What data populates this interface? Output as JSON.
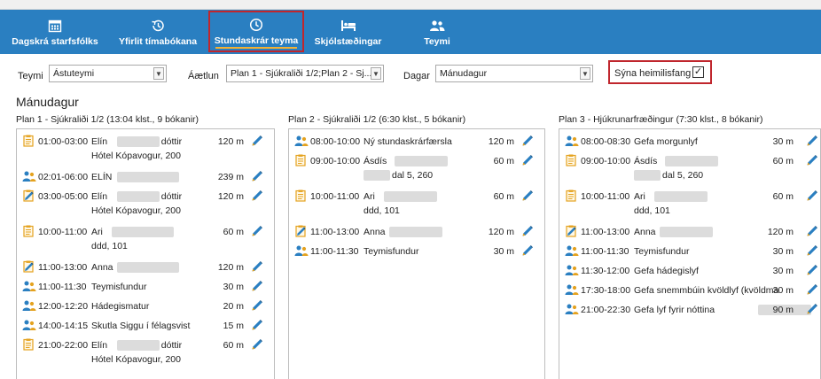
{
  "nav": {
    "items": [
      {
        "label": "Dagskrá starfsfólks",
        "icon": "calendar-icon"
      },
      {
        "label": "Yfirlit tímabókana",
        "icon": "history-icon"
      },
      {
        "label": "Stundaskrár teyma",
        "icon": "clock-icon"
      },
      {
        "label": "Skjólstæðingar",
        "icon": "bed-icon"
      },
      {
        "label": "Teymi",
        "icon": "team-icon"
      }
    ],
    "active_index": 2,
    "colors": {
      "bar": "#2a7fc1",
      "active_border": "#c0262d",
      "active_underline": "#f2b134"
    }
  },
  "filters": {
    "team_label": "Teymi",
    "team_value": "Ástuteymi",
    "plan_label": "Áætlun",
    "plan_value": "Plan 1 - Sjúkraliði 1/2;Plan 2 - Sj...",
    "day_label": "Dagar",
    "day_value": "Mánudagur",
    "show_address_label": "Sýna heimilisfang",
    "show_address_checked": "✓"
  },
  "day_title": "Mánudagur",
  "plans": [
    {
      "title": "Plan 1 - Sjúkraliði 1/2 (13:04 klst., 9 bókanir)",
      "entries": [
        {
          "time": "01:00-03:00",
          "name": "Elín",
          "suffix": "dóttir",
          "minutes": "120 m",
          "icon": "booking-icon",
          "address": "Hótel Kópavogur, 200"
        },
        {
          "time": "02:01-06:00",
          "name": "ELÍN",
          "suffix": "",
          "minutes": "239 m",
          "icon": "group-icon",
          "address": ""
        },
        {
          "time": "03:00-05:00",
          "name": "Elín",
          "suffix": "dóttir",
          "minutes": "120 m",
          "icon": "edited-booking-icon",
          "address": "Hótel Kópavogur, 200"
        },
        {
          "time": "10:00-11:00",
          "name": "Ari",
          "suffix": "",
          "minutes": "60 m",
          "icon": "booking-icon",
          "address": "ddd, 101"
        },
        {
          "time": "11:00-13:00",
          "name": "Anna",
          "suffix": "",
          "minutes": "120 m",
          "icon": "edited-booking-icon",
          "address": ""
        },
        {
          "time": "11:00-11:30",
          "name": "Teymisfundur",
          "suffix": "",
          "minutes": "30 m",
          "icon": "group-icon",
          "address": ""
        },
        {
          "time": "12:00-12:20",
          "name": "Hádegismatur",
          "suffix": "",
          "minutes": "20 m",
          "icon": "group-icon",
          "address": ""
        },
        {
          "time": "14:00-14:15",
          "name": "Skutla Siggu í félagsvist",
          "suffix": "",
          "minutes": "15 m",
          "icon": "group-icon",
          "address": ""
        },
        {
          "time": "21:00-22:00",
          "name": "Elín",
          "suffix": "dóttir",
          "minutes": "60 m",
          "icon": "booking-icon",
          "address": "Hótel Kópavogur, 200"
        }
      ]
    },
    {
      "title": "Plan 2 - Sjúkraliði 1/2 (6:30 klst., 5 bókanir)",
      "entries": [
        {
          "time": "08:00-10:00",
          "name": "Ný stundaskrárfærsla",
          "suffix": "",
          "minutes": "120 m",
          "icon": "group-icon",
          "address": ""
        },
        {
          "time": "09:00-10:00",
          "name": "Ásdís",
          "suffix": "",
          "minutes": "60 m",
          "icon": "booking-icon",
          "address": "dal 5, 260"
        },
        {
          "time": "10:00-11:00",
          "name": "Ari",
          "suffix": "",
          "minutes": "60 m",
          "icon": "booking-icon",
          "address": "ddd, 101"
        },
        {
          "time": "11:00-13:00",
          "name": "Anna",
          "suffix": "",
          "minutes": "120 m",
          "icon": "edited-booking-icon",
          "address": ""
        },
        {
          "time": "11:00-11:30",
          "name": "Teymisfundur",
          "suffix": "",
          "minutes": "30 m",
          "icon": "group-icon",
          "address": ""
        }
      ]
    },
    {
      "title": "Plan 3 - Hjúkrunarfræðingur (7:30 klst., 8 bókanir)",
      "entries": [
        {
          "time": "08:00-08:30",
          "name": "Gefa morgunlyf",
          "suffix": "",
          "minutes": "30 m",
          "icon": "group-icon",
          "address": ""
        },
        {
          "time": "09:00-10:00",
          "name": "Ásdís",
          "suffix": "",
          "minutes": "60 m",
          "icon": "booking-icon",
          "address": "dal 5, 260"
        },
        {
          "time": "10:00-11:00",
          "name": "Ari",
          "suffix": "",
          "minutes": "60 m",
          "icon": "booking-icon",
          "address": "ddd, 101"
        },
        {
          "time": "11:00-13:00",
          "name": "Anna",
          "suffix": "",
          "minutes": "120 m",
          "icon": "edited-booking-icon",
          "address": ""
        },
        {
          "time": "11:00-11:30",
          "name": "Teymisfundur",
          "suffix": "",
          "minutes": "30 m",
          "icon": "group-icon",
          "address": ""
        },
        {
          "time": "11:30-12:00",
          "name": "Gefa hádegislyf",
          "suffix": "",
          "minutes": "30 m",
          "icon": "group-icon",
          "address": ""
        },
        {
          "time": "17:30-18:00",
          "name": "Gefa snemmbúin kvöldlyf (kvöldma",
          "suffix": "",
          "minutes": "30 m",
          "icon": "group-icon",
          "address": ""
        },
        {
          "time": "21:00-22:30",
          "name": "Gefa lyf fyrir nóttina",
          "suffix": "",
          "minutes": "90 m",
          "icon": "group-icon",
          "address": ""
        }
      ]
    }
  ]
}
